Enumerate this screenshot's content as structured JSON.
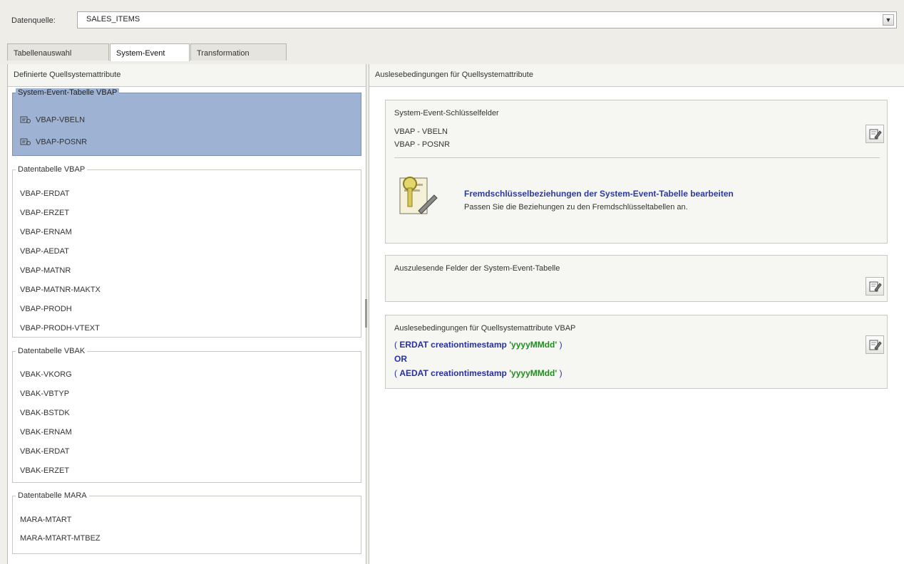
{
  "datasource": {
    "label": "Datenquelle:",
    "value": "SALES_ITEMS"
  },
  "tabs": [
    {
      "label": "Tabellenauswahl"
    },
    {
      "label": "System-Event"
    },
    {
      "label": "Transformation"
    }
  ],
  "left": {
    "header": "Definierte Quellsystemattribute",
    "groups": [
      {
        "title": "System-Event-Tabelle VBAP",
        "items": [
          "VBAP-VBELN",
          "VBAP-POSNR"
        ]
      },
      {
        "title": "Datentabelle VBAP",
        "items": [
          "VBAP-ERDAT",
          "VBAP-ERZET",
          "VBAP-ERNAM",
          "VBAP-AEDAT",
          "VBAP-MATNR",
          "VBAP-MATNR-MAKTX",
          "VBAP-PRODH",
          "VBAP-PRODH-VTEXT"
        ]
      },
      {
        "title": "Datentabelle VBAK",
        "items": [
          "VBAK-VKORG",
          "VBAK-VBTYP",
          "VBAK-BSTDK",
          "VBAK-ERNAM",
          "VBAK-ERDAT",
          "VBAK-ERZET"
        ]
      },
      {
        "title": "Datentabelle MARA",
        "items": [
          "MARA-MTART",
          "MARA-MTART-MTBEZ"
        ]
      }
    ]
  },
  "right": {
    "header": "Auslesebedingungen für Quellsystemattribute",
    "key_fields": {
      "title": "System-Event-Schlüsselfelder",
      "fields": [
        "VBAP - VBELN",
        "VBAP - POSNR"
      ],
      "fk_link": "Fremdschlüsselbeziehungen der System-Event-Tabelle bearbeiten",
      "fk_desc": "Passen Sie die Beziehungen zu den Fremdschlüsseltabellen an."
    },
    "read_fields": {
      "title": "Auszulesende Felder der System-Event-Tabelle"
    },
    "conditions": {
      "title": "Auslesebedingungen für Quellsystemattribute VBAP",
      "lines": [
        {
          "open": "(",
          "field": "ERDAT",
          "keyword": "creationtimestamp",
          "format": "'yyyyMMdd'",
          "close": ")"
        },
        {
          "operator": "OR"
        },
        {
          "open": "(",
          "field": "AEDAT",
          "keyword": "creationtimestamp",
          "format": "'yyyyMMdd'",
          "close": ")"
        }
      ]
    }
  },
  "icons": {
    "edit": "edit-pencil-icon",
    "key_value": "key-value-icon",
    "foreign_key": "foreign-key-document-icon",
    "dropdown": "chevron-down-icon"
  }
}
